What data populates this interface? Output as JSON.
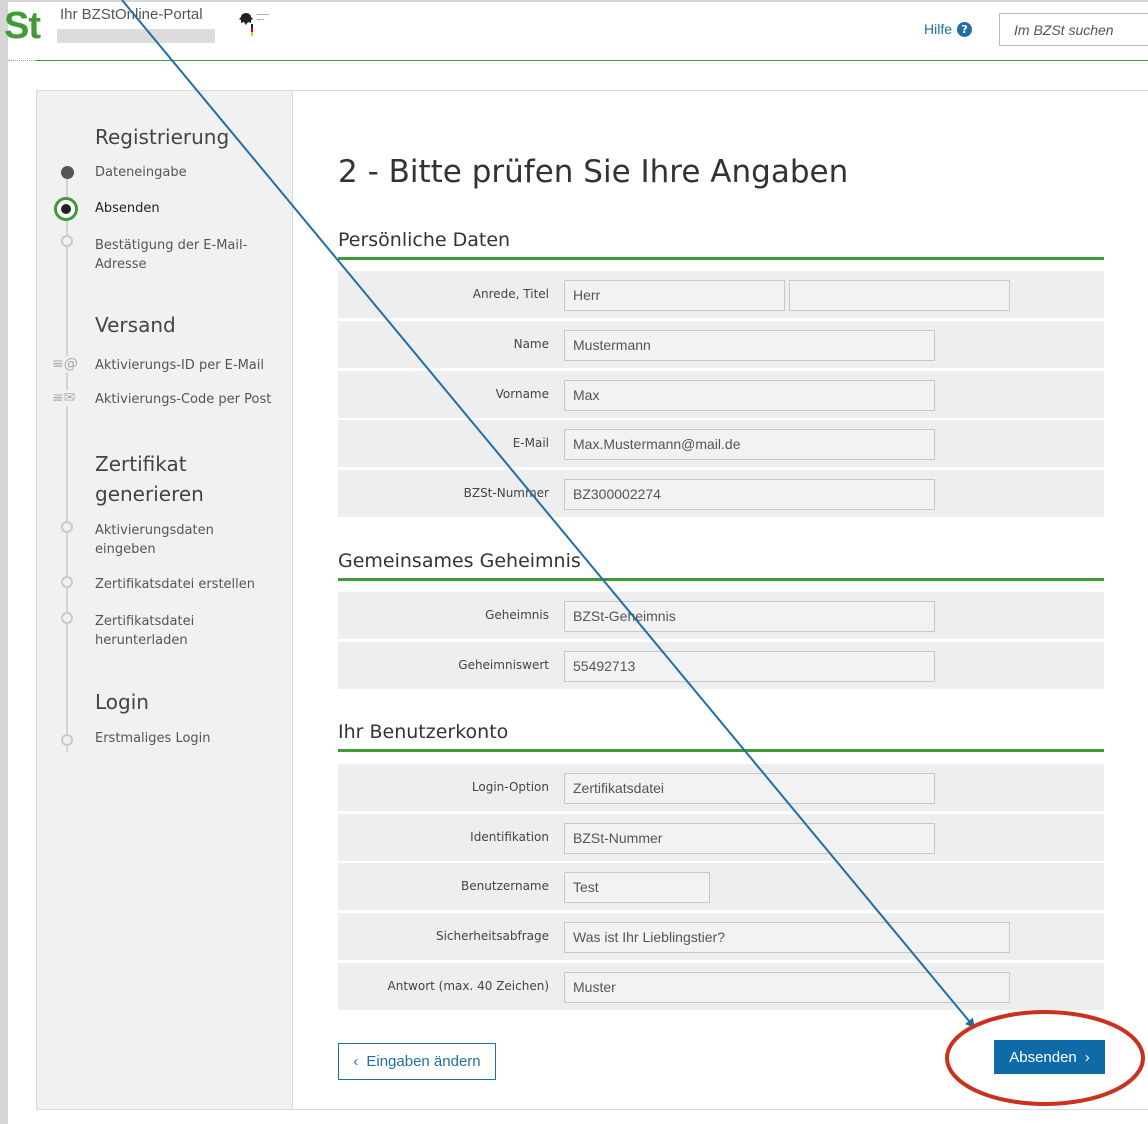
{
  "header": {
    "logo": "St",
    "portal_title": "Ihr BZStOnline-Portal",
    "help_label": "Hilfe",
    "help_icon": "question-circle-icon",
    "search_placeholder": "Im BZSt suchen"
  },
  "sidebar": {
    "sections": [
      {
        "title": "Registrierung",
        "steps": [
          "Dateneingabe",
          "Absenden",
          "Bestätigung der E-Mail-Adresse"
        ]
      },
      {
        "title": "Versand",
        "steps": [
          "Aktivierungs-ID per E-Mail",
          "Aktivierungs-Code per Post"
        ]
      },
      {
        "title": "Zertifikat generieren",
        "steps": [
          "Aktivierungsdaten eingeben",
          "Zertifikatsdatei erstellen",
          "Zertifikatsdatei herunterladen"
        ]
      },
      {
        "title": "Login",
        "steps": [
          "Erstmaliges Login"
        ]
      }
    ],
    "current_step": "Absenden"
  },
  "main": {
    "title": "2 - Bitte prüfen Sie Ihre Angaben",
    "personal": {
      "heading": "Persönliche Daten",
      "salutation_label": "Anrede,  Titel",
      "salutation_value": "Herr",
      "title_value": "",
      "name_label": "Name",
      "name_value": "Mustermann",
      "firstname_label": "Vorname",
      "firstname_value": "Max",
      "email_label": "E-Mail",
      "email_value": "Max.Mustermann@mail.de",
      "bzst_label": "BZSt-Nummer",
      "bzst_value": "BZ300002274"
    },
    "secret": {
      "heading": "Gemeinsames Geheimnis",
      "secret_label": "Geheimnis",
      "secret_value": "BZSt-Geheimnis",
      "secret_val_label": "Geheimniswert",
      "secret_val_value": "55492713"
    },
    "account": {
      "heading": "Ihr Benutzerkonto",
      "login_option_label": "Login-Option",
      "login_option_value": "Zertifikatsdatei",
      "identification_label": "Identifikation",
      "identification_value": "BZSt-Nummer",
      "username_label": "Benutzername",
      "username_value": "Test",
      "security_q_label": "Sicherheitsabfrage",
      "security_q_value": "Was ist Ihr Lieblingstier?",
      "answer_label": "Antwort (max. 40 Zeichen)",
      "answer_value": "Muster"
    },
    "buttons": {
      "back_label": "Eingaben ändern",
      "submit_label": "Absenden"
    }
  },
  "colors": {
    "accent_green": "#3f9b35",
    "button_blue": "#0f6ba8",
    "arrow_blue": "#1f6fa6",
    "highlight_red": "#c8321e"
  }
}
